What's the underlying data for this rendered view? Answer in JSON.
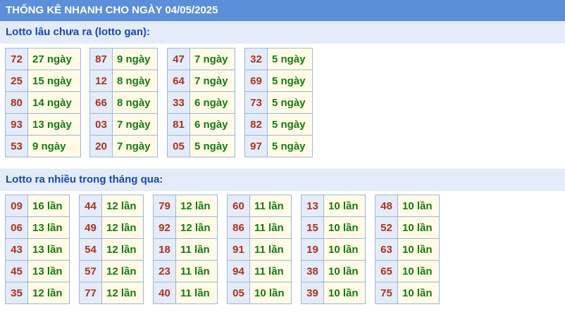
{
  "title": "THỐNG KÊ NHANH CHO NGÀY 04/05/2025",
  "gan": {
    "heading": "Lotto lâu chưa ra (lotto gan):",
    "groups": [
      [
        [
          "72",
          "27 ngày"
        ],
        [
          "25",
          "15 ngày"
        ],
        [
          "80",
          "14 ngày"
        ],
        [
          "93",
          "13 ngày"
        ],
        [
          "53",
          "9 ngày"
        ]
      ],
      [
        [
          "87",
          "9 ngày"
        ],
        [
          "12",
          "8 ngày"
        ],
        [
          "66",
          "8 ngày"
        ],
        [
          "03",
          "7 ngày"
        ],
        [
          "20",
          "7 ngày"
        ]
      ],
      [
        [
          "47",
          "7 ngày"
        ],
        [
          "64",
          "7 ngày"
        ],
        [
          "33",
          "6 ngày"
        ],
        [
          "81",
          "6 ngày"
        ],
        [
          "05",
          "5 ngày"
        ]
      ],
      [
        [
          "32",
          "5 ngày"
        ],
        [
          "69",
          "5 ngày"
        ],
        [
          "73",
          "5 ngày"
        ],
        [
          "82",
          "5 ngày"
        ],
        [
          "97",
          "5 ngày"
        ]
      ]
    ]
  },
  "nhieu": {
    "heading": "Lotto ra nhiều trong tháng qua:",
    "groups": [
      [
        [
          "09",
          "16 lần"
        ],
        [
          "06",
          "13 lần"
        ],
        [
          "43",
          "13 lần"
        ],
        [
          "45",
          "13 lần"
        ],
        [
          "35",
          "12 lần"
        ]
      ],
      [
        [
          "44",
          "12 lần"
        ],
        [
          "49",
          "12 lần"
        ],
        [
          "54",
          "12 lần"
        ],
        [
          "57",
          "12 lần"
        ],
        [
          "77",
          "12 lần"
        ]
      ],
      [
        [
          "79",
          "12 lần"
        ],
        [
          "92",
          "12 lần"
        ],
        [
          "18",
          "11 lần"
        ],
        [
          "23",
          "11 lần"
        ],
        [
          "40",
          "11 lần"
        ]
      ],
      [
        [
          "60",
          "11 lần"
        ],
        [
          "86",
          "11 lần"
        ],
        [
          "91",
          "11 lần"
        ],
        [
          "94",
          "11 lần"
        ],
        [
          "05",
          "10 lần"
        ]
      ],
      [
        [
          "13",
          "10 lần"
        ],
        [
          "15",
          "10 lần"
        ],
        [
          "19",
          "10 lần"
        ],
        [
          "38",
          "10 lần"
        ],
        [
          "39",
          "10 lần"
        ]
      ],
      [
        [
          "48",
          "10 lần"
        ],
        [
          "52",
          "10 lần"
        ],
        [
          "63",
          "10 lần"
        ],
        [
          "65",
          "10 lần"
        ],
        [
          "75",
          "10 lần"
        ]
      ]
    ]
  }
}
